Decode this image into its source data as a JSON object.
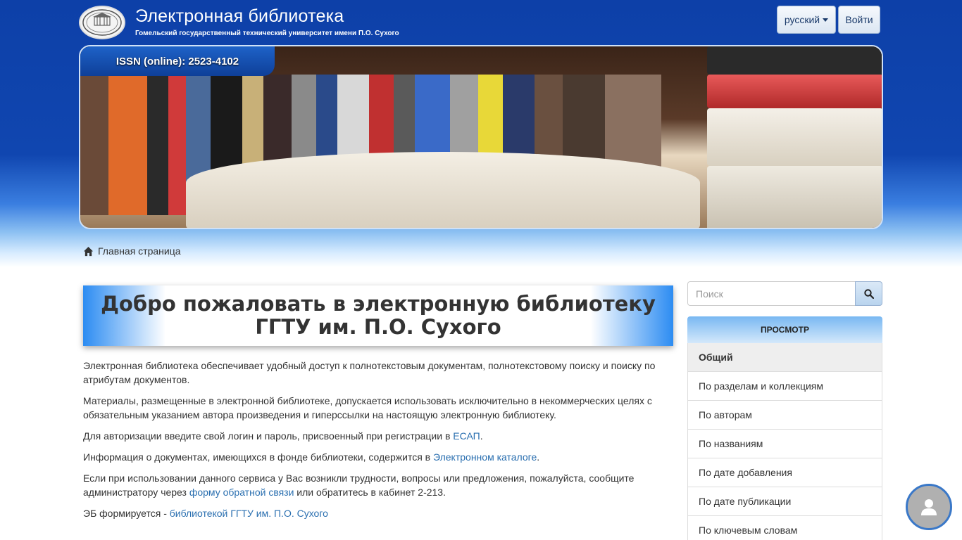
{
  "header": {
    "title": "Электронная библиотека",
    "subtitle": "Гомельский государственный технический университет имени П.О. Сухого",
    "logo_icon": "university-seal-icon",
    "language_label": "русский",
    "login_label": "Войти"
  },
  "banner": {
    "issn": "ISSN (online): 2523-4102"
  },
  "breadcrumb": {
    "home_label": "Главная страница"
  },
  "welcome": {
    "line1": "Добро пожаловать в электронную библиотеку",
    "line2": "ГГТУ им. П.О. Сухого"
  },
  "content": {
    "p1": "Электронная библиотека обеспечивает удобный доступ к полнотекстовым документам, полнотекстовому поиску и поиску по атрибутам документов.",
    "p2": "Материалы, размещенные в электронной библиотеке, допускается использовать исключительно в некоммерческих целях с обязательным указанием автора произведения и гиперссылки на настоящую электронную библиотеку.",
    "p3_before": "Для авторизации введите свой логин и пароль, присвоенный при регистрации в ",
    "p3_link": "ЕСАП",
    "p3_after": ".",
    "p4_before": "Информация о документах, имеющихся в фонде библиотеки, содержится в ",
    "p4_link": "Электронном каталоге",
    "p4_after": ".",
    "p5_before": "Если при использовании данного сервиса у Вас возникли трудности, вопросы или предложения, пожалуйста, сообщите администратору через ",
    "p5_link": "форму обратной связи",
    "p5_after": " или обратитесь в кабинет 2-213.",
    "p6_before": "ЭБ формируется - ",
    "p6_link": "библиотекой ГГТУ им. П.О. Сухого"
  },
  "sidebar": {
    "search_placeholder": "Поиск",
    "browse_title": "ПРОСМОТР",
    "items": [
      {
        "label": "Общий",
        "active": true
      },
      {
        "label": "По разделам и коллекциям"
      },
      {
        "label": "По авторам"
      },
      {
        "label": "По названиям"
      },
      {
        "label": "По дате добавления"
      },
      {
        "label": "По дате публикации"
      },
      {
        "label": "По ключевым словам"
      }
    ]
  },
  "colors": {
    "header_blue": "#0d40a8",
    "link": "#2a6fb0",
    "accent_blue": "#2c8cf2"
  }
}
